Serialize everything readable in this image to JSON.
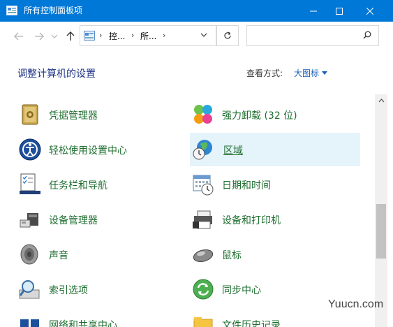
{
  "window": {
    "title": "所有控制面板项",
    "accent": "#0078d7"
  },
  "address": {
    "crumbs": [
      "控...",
      "所..."
    ],
    "search_placeholder": ""
  },
  "header": {
    "title": "调整计算机的设置",
    "view_by_label": "查看方式:",
    "view_by_value": "大图标"
  },
  "items": [
    {
      "label": "凭据管理器",
      "icon": "credential-manager-icon"
    },
    {
      "label": "强力卸载 (32 位)",
      "icon": "uninstaller-icon"
    },
    {
      "label": "轻松使用设置中心",
      "icon": "ease-of-access-icon"
    },
    {
      "label": "区域",
      "icon": "region-globe-icon"
    },
    {
      "label": "任务栏和导航",
      "icon": "taskbar-icon"
    },
    {
      "label": "日期和时间",
      "icon": "calendar-clock-icon"
    },
    {
      "label": "设备管理器",
      "icon": "device-manager-icon"
    },
    {
      "label": "设备和打印机",
      "icon": "printer-icon"
    },
    {
      "label": "声音",
      "icon": "speaker-icon"
    },
    {
      "label": "鼠标",
      "icon": "mouse-icon"
    },
    {
      "label": "索引选项",
      "icon": "indexing-icon"
    },
    {
      "label": "同步中心",
      "icon": "sync-center-icon"
    },
    {
      "label": "网络和共享中心",
      "icon": "network-icon"
    },
    {
      "label": "文件历史记录",
      "icon": "file-history-icon"
    }
  ],
  "watermark": "Yuucn.com"
}
